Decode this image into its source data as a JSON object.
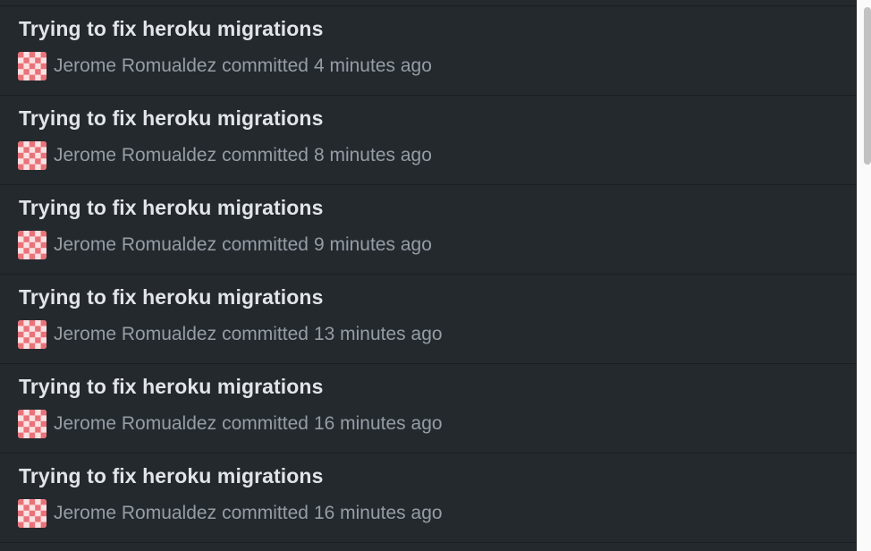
{
  "commits": [
    {
      "title": "Trying to fix heroku migrations",
      "author": "Jerome Romualdez",
      "action": "committed",
      "time": "4 minutes ago"
    },
    {
      "title": "Trying to fix heroku migrations",
      "author": "Jerome Romualdez",
      "action": "committed",
      "time": "8 minutes ago"
    },
    {
      "title": "Trying to fix heroku migrations",
      "author": "Jerome Romualdez",
      "action": "committed",
      "time": "9 minutes ago"
    },
    {
      "title": "Trying to fix heroku migrations",
      "author": "Jerome Romualdez",
      "action": "committed",
      "time": "13 minutes ago"
    },
    {
      "title": "Trying to fix heroku migrations",
      "author": "Jerome Romualdez",
      "action": "committed",
      "time": "16 minutes ago"
    },
    {
      "title": "Trying to fix heroku migrations",
      "author": "Jerome Romualdez",
      "action": "committed",
      "time": "16 minutes ago"
    }
  ],
  "avatar": {
    "icon": "identicon-avatar",
    "colors": {
      "primary": "#e8737a",
      "secondary": "#fbe1e2"
    }
  },
  "theme": {
    "background": "#24292e",
    "title": "#e1e4e8",
    "meta": "#959da5",
    "divider": "#1b1f23"
  }
}
